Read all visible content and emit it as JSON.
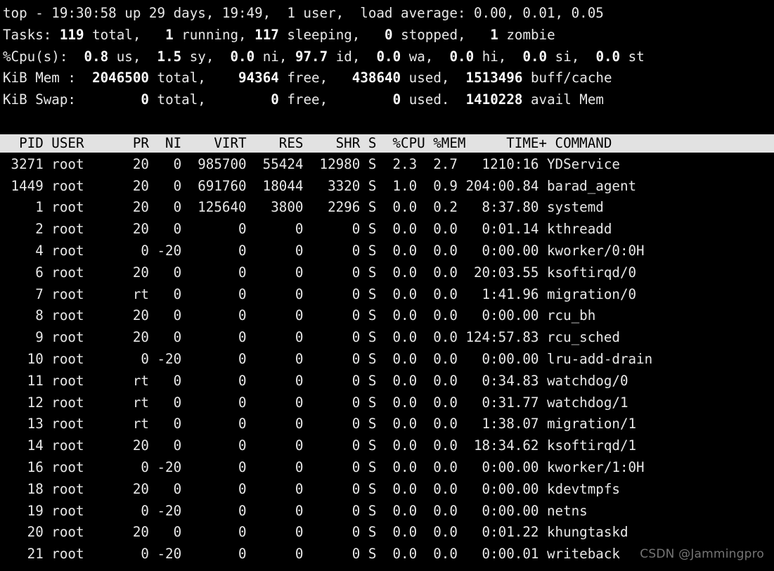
{
  "terminal": {
    "program": "top",
    "colors": {
      "background": "#000000",
      "foreground": "#e8e8e8",
      "header_bar_background": "#e2e2e2",
      "header_bar_foreground": "#000000",
      "watermark": "#8a8a8a"
    }
  },
  "summary": {
    "uptime_line": {
      "program": "top",
      "separator": "-",
      "time": "19:30:58",
      "up_label": "up",
      "uptime_days": "29 days,",
      "uptime_hm": "19:49,",
      "users": "1 user,",
      "load_label": "load average:",
      "load_1min": "0.00,",
      "load_5min": "0.01,",
      "load_15min": "0.05",
      "full": "top - 19:30:58 up 29 days, 19:49,  1 user,  load average: 0.00, 0.01, 0.05"
    },
    "tasks_line": {
      "label": "Tasks:",
      "total": "119",
      "total_label": "total,",
      "running": "1",
      "running_label": "running,",
      "sleeping": "117",
      "sleeping_label": "sleeping,",
      "stopped": "0",
      "stopped_label": "stopped,",
      "zombie": "1",
      "zombie_label": "zombie"
    },
    "cpu_line": {
      "label": "%Cpu(s):",
      "us": "0.8",
      "us_label": "us,",
      "sy": "1.5",
      "sy_label": "sy,",
      "ni": "0.0",
      "ni_label": "ni,",
      "id": "97.7",
      "id_label": "id,",
      "wa": "0.0",
      "wa_label": "wa,",
      "hi": "0.0",
      "hi_label": "hi,",
      "si": "0.0",
      "si_label": "si,",
      "st": "0.0",
      "st_label": "st"
    },
    "mem_line": {
      "label": "KiB Mem :",
      "total": "2046500",
      "total_label": "total,",
      "free": "94364",
      "free_label": "free,",
      "used": "438640",
      "used_label": "used,",
      "buff_cache": "1513496",
      "buff_cache_label": "buff/cache"
    },
    "swap_line": {
      "label": "KiB Swap:",
      "total": "0",
      "total_label": "total,",
      "free": "0",
      "free_label": "free,",
      "used": "0",
      "used_label": "used.",
      "avail": "1410228",
      "avail_label": "avail Mem"
    }
  },
  "table": {
    "columns": [
      "PID",
      "USER",
      "PR",
      "NI",
      "VIRT",
      "RES",
      "SHR",
      "S",
      "%CPU",
      "%MEM",
      "TIME+",
      "COMMAND"
    ],
    "header_row": "  PID USER      PR  NI    VIRT    RES    SHR S  %CPU %MEM     TIME+ COMMAND",
    "rows": [
      {
        "pid": "3271",
        "user": "root",
        "pr": "20",
        "ni": "0",
        "virt": "985700",
        "res": "55424",
        "shr": "12980",
        "s": "S",
        "cpu": "2.3",
        "mem": "2.7",
        "time": "1210:16",
        "command": "YDService"
      },
      {
        "pid": "1449",
        "user": "root",
        "pr": "20",
        "ni": "0",
        "virt": "691760",
        "res": "18044",
        "shr": "3320",
        "s": "S",
        "cpu": "1.0",
        "mem": "0.9",
        "time": "204:00.84",
        "command": "barad_agent"
      },
      {
        "pid": "1",
        "user": "root",
        "pr": "20",
        "ni": "0",
        "virt": "125640",
        "res": "3800",
        "shr": "2296",
        "s": "S",
        "cpu": "0.0",
        "mem": "0.2",
        "time": "8:37.80",
        "command": "systemd"
      },
      {
        "pid": "2",
        "user": "root",
        "pr": "20",
        "ni": "0",
        "virt": "0",
        "res": "0",
        "shr": "0",
        "s": "S",
        "cpu": "0.0",
        "mem": "0.0",
        "time": "0:01.14",
        "command": "kthreadd"
      },
      {
        "pid": "4",
        "user": "root",
        "pr": "0",
        "ni": "-20",
        "virt": "0",
        "res": "0",
        "shr": "0",
        "s": "S",
        "cpu": "0.0",
        "mem": "0.0",
        "time": "0:00.00",
        "command": "kworker/0:0H"
      },
      {
        "pid": "6",
        "user": "root",
        "pr": "20",
        "ni": "0",
        "virt": "0",
        "res": "0",
        "shr": "0",
        "s": "S",
        "cpu": "0.0",
        "mem": "0.0",
        "time": "20:03.55",
        "command": "ksoftirqd/0"
      },
      {
        "pid": "7",
        "user": "root",
        "pr": "rt",
        "ni": "0",
        "virt": "0",
        "res": "0",
        "shr": "0",
        "s": "S",
        "cpu": "0.0",
        "mem": "0.0",
        "time": "1:41.96",
        "command": "migration/0"
      },
      {
        "pid": "8",
        "user": "root",
        "pr": "20",
        "ni": "0",
        "virt": "0",
        "res": "0",
        "shr": "0",
        "s": "S",
        "cpu": "0.0",
        "mem": "0.0",
        "time": "0:00.00",
        "command": "rcu_bh"
      },
      {
        "pid": "9",
        "user": "root",
        "pr": "20",
        "ni": "0",
        "virt": "0",
        "res": "0",
        "shr": "0",
        "s": "S",
        "cpu": "0.0",
        "mem": "0.0",
        "time": "124:57.83",
        "command": "rcu_sched"
      },
      {
        "pid": "10",
        "user": "root",
        "pr": "0",
        "ni": "-20",
        "virt": "0",
        "res": "0",
        "shr": "0",
        "s": "S",
        "cpu": "0.0",
        "mem": "0.0",
        "time": "0:00.00",
        "command": "lru-add-drain"
      },
      {
        "pid": "11",
        "user": "root",
        "pr": "rt",
        "ni": "0",
        "virt": "0",
        "res": "0",
        "shr": "0",
        "s": "S",
        "cpu": "0.0",
        "mem": "0.0",
        "time": "0:34.83",
        "command": "watchdog/0"
      },
      {
        "pid": "12",
        "user": "root",
        "pr": "rt",
        "ni": "0",
        "virt": "0",
        "res": "0",
        "shr": "0",
        "s": "S",
        "cpu": "0.0",
        "mem": "0.0",
        "time": "0:31.77",
        "command": "watchdog/1"
      },
      {
        "pid": "13",
        "user": "root",
        "pr": "rt",
        "ni": "0",
        "virt": "0",
        "res": "0",
        "shr": "0",
        "s": "S",
        "cpu": "0.0",
        "mem": "0.0",
        "time": "1:38.07",
        "command": "migration/1"
      },
      {
        "pid": "14",
        "user": "root",
        "pr": "20",
        "ni": "0",
        "virt": "0",
        "res": "0",
        "shr": "0",
        "s": "S",
        "cpu": "0.0",
        "mem": "0.0",
        "time": "18:34.62",
        "command": "ksoftirqd/1"
      },
      {
        "pid": "16",
        "user": "root",
        "pr": "0",
        "ni": "-20",
        "virt": "0",
        "res": "0",
        "shr": "0",
        "s": "S",
        "cpu": "0.0",
        "mem": "0.0",
        "time": "0:00.00",
        "command": "kworker/1:0H"
      },
      {
        "pid": "18",
        "user": "root",
        "pr": "20",
        "ni": "0",
        "virt": "0",
        "res": "0",
        "shr": "0",
        "s": "S",
        "cpu": "0.0",
        "mem": "0.0",
        "time": "0:00.00",
        "command": "kdevtmpfs"
      },
      {
        "pid": "19",
        "user": "root",
        "pr": "0",
        "ni": "-20",
        "virt": "0",
        "res": "0",
        "shr": "0",
        "s": "S",
        "cpu": "0.0",
        "mem": "0.0",
        "time": "0:00.00",
        "command": "netns"
      },
      {
        "pid": "20",
        "user": "root",
        "pr": "20",
        "ni": "0",
        "virt": "0",
        "res": "0",
        "shr": "0",
        "s": "S",
        "cpu": "0.0",
        "mem": "0.0",
        "time": "0:01.22",
        "command": "khungtaskd"
      },
      {
        "pid": "21",
        "user": "root",
        "pr": "0",
        "ni": "-20",
        "virt": "0",
        "res": "0",
        "shr": "0",
        "s": "S",
        "cpu": "0.0",
        "mem": "0.0",
        "time": "0:00.01",
        "command": "writeback"
      }
    ]
  },
  "watermark": {
    "text": "CSDN @Jammingpro"
  }
}
